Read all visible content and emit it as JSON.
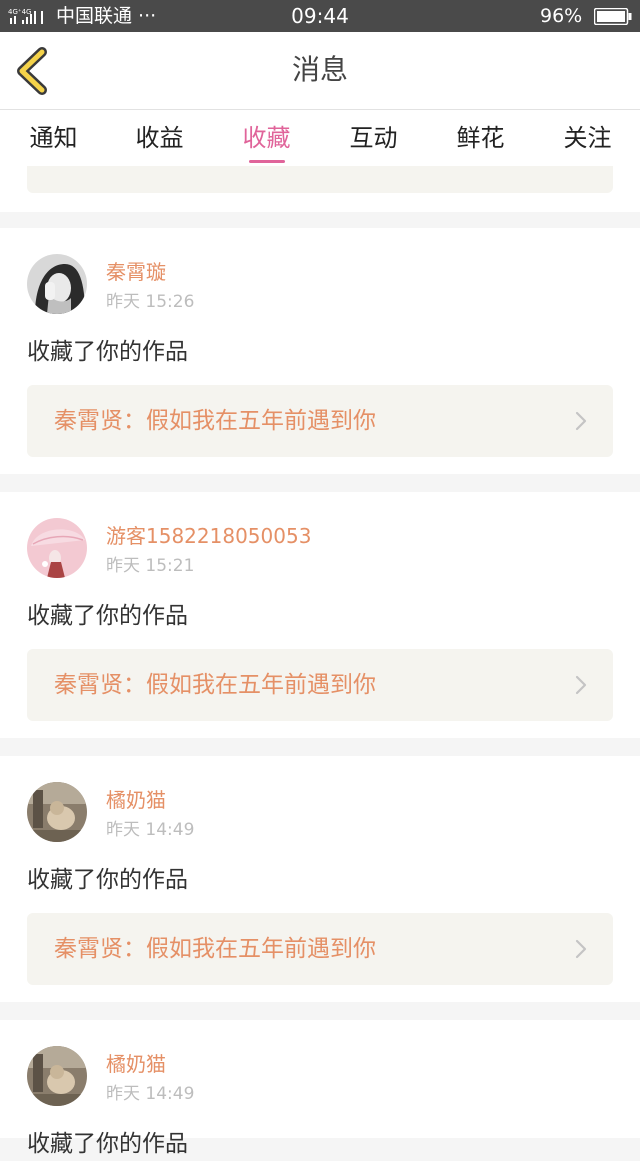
{
  "status_bar": {
    "network": "4G⁺4G",
    "carrier": "中国联通 ···",
    "time": "09:44",
    "battery": "96%"
  },
  "header": {
    "title": "消息"
  },
  "tabs": [
    {
      "label": "通知",
      "active": false
    },
    {
      "label": "收益",
      "active": false
    },
    {
      "label": "收藏",
      "active": true
    },
    {
      "label": "互动",
      "active": false
    },
    {
      "label": "鲜花",
      "active": false
    },
    {
      "label": "关注",
      "active": false
    }
  ],
  "colors": {
    "accent": "#e0649a",
    "username": "#e59066",
    "link_bg": "#f5f4ef",
    "status_bar": "#4a4a4a",
    "back_arrow_fill": "#f5d34a",
    "back_arrow_stroke": "#3a3a3a"
  },
  "messages": [
    {
      "user": "秦霄璇",
      "time": "昨天 15:26",
      "action": "收藏了你的作品",
      "work": "秦霄贤：假如我在五年前遇到你",
      "avatar": "avatar-girl-bw"
    },
    {
      "user": "游客1582218050053",
      "time": "昨天 15:21",
      "action": "收藏了你的作品",
      "work": "秦霄贤：假如我在五年前遇到你",
      "avatar": "avatar-pink-umbrella"
    },
    {
      "user": "橘奶猫",
      "time": "昨天 14:49",
      "action": "收藏了你的作品",
      "work": "秦霄贤：假如我在五年前遇到你",
      "avatar": "avatar-cat-photo"
    },
    {
      "user": "橘奶猫",
      "time": "昨天 14:49",
      "action": "收藏了你的作品",
      "work": "",
      "avatar": "avatar-cat-photo"
    }
  ]
}
